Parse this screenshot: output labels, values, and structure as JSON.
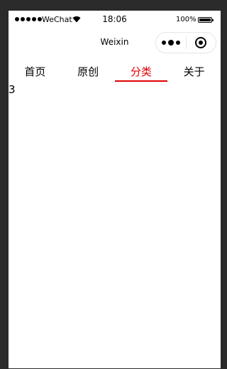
{
  "status_bar": {
    "carrier": "WeChat",
    "time": "18:06",
    "battery_percent": "100%",
    "battery_level": 1.0,
    "signal_icon": "signal-dots-icon",
    "wifi_icon": "wifi-icon"
  },
  "nav_bar": {
    "title": "Weixin",
    "more_icon": "more-dots-icon",
    "close_icon": "target-circle-icon"
  },
  "tabs": [
    {
      "label": "首页",
      "active": false
    },
    {
      "label": "原创",
      "active": false
    },
    {
      "label": "分类",
      "active": true
    },
    {
      "label": "关于",
      "active": false
    }
  ],
  "content": {
    "text": "3"
  },
  "colors": {
    "active_tab": "#e00000",
    "background": "#2b2b2b",
    "page": "#ffffff"
  }
}
